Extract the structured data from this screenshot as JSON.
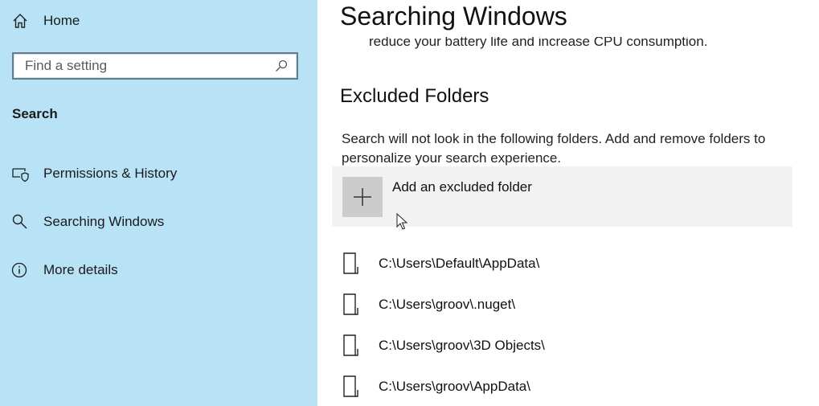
{
  "sidebar": {
    "home_label": "Home",
    "search_placeholder": "Find a setting",
    "section_title": "Search",
    "items": [
      {
        "label": "Permissions & History",
        "icon": "shield-monitor-icon"
      },
      {
        "label": "Searching Windows",
        "icon": "search-icon"
      },
      {
        "label": "More details",
        "icon": "info-icon"
      }
    ]
  },
  "main": {
    "title": "Searching Windows",
    "cut_text": "reduce your battery life and increase CPU consumption.",
    "excluded_heading": "Excluded Folders",
    "description": "Search will not look in the following folders. Add and remove folders to personalize your search experience.",
    "add_folder_label": "Add an excluded folder",
    "folders": [
      "C:\\Users\\Default\\AppData\\",
      "C:\\Users\\groov\\.nuget\\",
      "C:\\Users\\groov\\3D Objects\\",
      "C:\\Users\\groov\\AppData\\"
    ]
  },
  "colors": {
    "sidebar_bg": "#b8e3f7",
    "add_tile_bg": "#f2f2f2",
    "plus_tile_bg": "#cccccc"
  }
}
